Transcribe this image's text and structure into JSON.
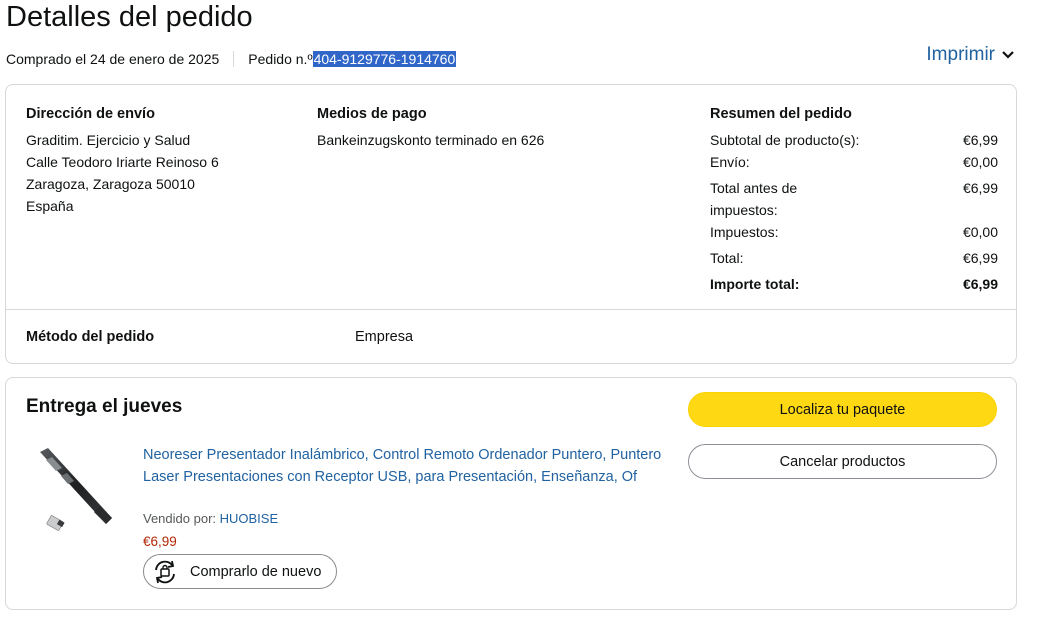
{
  "page": {
    "title": "Detalles del pedido",
    "purchased": "Comprado el 24 de enero de 2025",
    "order_label": "Pedido n.º ",
    "order_number": "404-9129776-1914760",
    "print": "Imprimir"
  },
  "shipping": {
    "heading": "Dirección de envío",
    "lines": [
      "Graditim. Ejercicio y Salud",
      "Calle Teodoro Iriarte Reinoso 6",
      "Zaragoza, Zaragoza 50010",
      "España"
    ]
  },
  "payment": {
    "heading": "Medios de pago",
    "method": "Bankeinzugskonto terminado en 626"
  },
  "summary": {
    "heading": "Resumen del pedido",
    "rows": [
      {
        "label": "Subtotal de producto(s):",
        "value": "€6,99"
      },
      {
        "label": "Envío:",
        "value": "€0,00"
      },
      {
        "label": "Total antes de impuestos:",
        "value": "€6,99"
      },
      {
        "label": "Impuestos:",
        "value": "€0,00"
      },
      {
        "label": "Total:",
        "value": "€6,99"
      }
    ],
    "grand_total_label": "Importe total:",
    "grand_total_value": "€6,99"
  },
  "order_method": {
    "label": "Método del pedido",
    "value": "Empresa"
  },
  "delivery": {
    "title": "Entrega el jueves",
    "product_title": "Neoreser Presentador Inalámbrico, Control Remoto Ordenador Puntero, Puntero Laser Presentaciones con Receptor USB, para Presentación, Enseñanza, Of",
    "sold_by_label": "Vendido por: ",
    "seller": "HUOBISE",
    "price": "€6,99",
    "buy_again": "Comprarlo de nuevo",
    "track_button": "Localiza tu paquete",
    "cancel_button": "Cancelar productos"
  },
  "colors": {
    "link": "#2162a1",
    "price": "#b12704",
    "primary_button": "#ffd814",
    "selection": "#3166c9"
  }
}
